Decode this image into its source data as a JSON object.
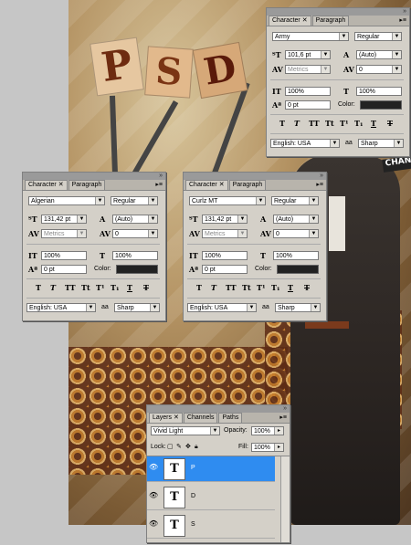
{
  "artwork": {
    "letters": [
      "P",
      "S",
      "D"
    ],
    "tag_text": "CHANGE"
  },
  "char_panel_top": {
    "tabs": [
      "Character",
      "Paragraph"
    ],
    "font_family": "Army",
    "font_style": "Regular",
    "size": "101,6 pt",
    "leading": "(Auto)",
    "kerning": "Metrics",
    "tracking": "0",
    "vscale": "100%",
    "hscale": "100%",
    "baseline": "0 pt",
    "color_label": "Color:",
    "language": "English: USA",
    "antialias_icon": "aa",
    "antialias": "Sharp"
  },
  "char_panel_left": {
    "tabs": [
      "Character",
      "Paragraph"
    ],
    "font_family": "Algerian",
    "font_style": "Regular",
    "size": "131,42 pt",
    "leading": "(Auto)",
    "kerning": "Metrics",
    "tracking": "0",
    "vscale": "100%",
    "hscale": "100%",
    "baseline": "0 pt",
    "color_label": "Color:",
    "language": "English: USA",
    "antialias_icon": "aa",
    "antialias": "Sharp"
  },
  "char_panel_mid": {
    "tabs": [
      "Character",
      "Paragraph"
    ],
    "font_family": "Curlz MT",
    "font_style": "Regular",
    "size": "131,42 pt",
    "leading": "(Auto)",
    "kerning": "Metrics",
    "tracking": "0",
    "vscale": "100%",
    "hscale": "100%",
    "baseline": "0 pt",
    "color_label": "Color:",
    "language": "English: USA",
    "antialias_icon": "aa",
    "antialias": "Sharp"
  },
  "type_buttons": [
    "T",
    "T",
    "TT",
    "Tt",
    "T¹",
    "T₁",
    "T",
    "T"
  ],
  "layers_panel": {
    "tabs": [
      "Layers",
      "Channels",
      "Paths"
    ],
    "blend_mode": "Vivid Light",
    "opacity_label": "Opacity:",
    "opacity": "100%",
    "lock_label": "Lock:",
    "fill_label": "Fill:",
    "fill": "100%",
    "layers": [
      {
        "thumb": "T",
        "name": "P",
        "selected": true
      },
      {
        "thumb": "T",
        "name": "D",
        "selected": false
      },
      {
        "thumb": "T",
        "name": "S",
        "selected": false
      }
    ]
  },
  "colors": {
    "selected_layer": "#2f8cf0",
    "text_color_swatch": "#222222"
  }
}
